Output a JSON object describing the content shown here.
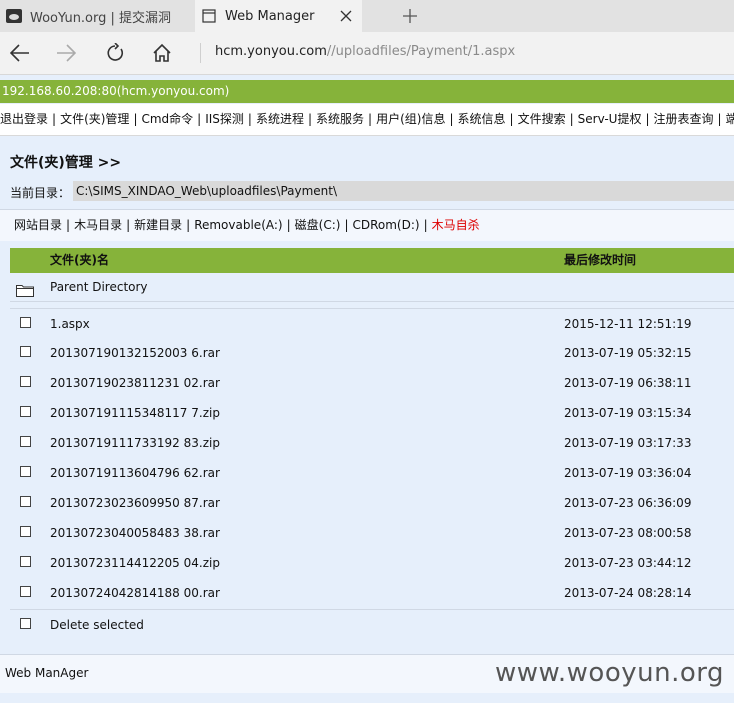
{
  "browser": {
    "tabs": [
      {
        "title": "WooYun.org | 提交漏洞"
      },
      {
        "title": "Web Manager"
      }
    ],
    "url_host": "hcm.yonyou.com",
    "url_path": "//uploadfiles/Payment/1.aspx"
  },
  "host_info": "192.168.60.208:80(hcm.yonyou.com)",
  "menu": [
    "退出登录",
    "文件(夹)管理",
    "Cmd命令",
    "IIS探测",
    "系统进程",
    "系统服务",
    "用户(组)信息",
    "系统信息",
    "文件搜索",
    "Serv-U提权",
    "注册表查询",
    "端口"
  ],
  "page_title": "文件(夹)管理 >>",
  "current_dir": {
    "label": "当前目录：",
    "value": "C:\\SIMS_XINDAO_Web\\uploadfiles\\Payment\\"
  },
  "drives": [
    "网站目录",
    "木马目录",
    "新建目录",
    "Removable(A:)",
    "磁盘(C:)",
    "CDRom(D:)"
  ],
  "self_kill": "木马自杀",
  "table": {
    "col_name": "文件(夹)名",
    "col_time": "最后修改时间",
    "parent": "Parent Directory",
    "files": [
      {
        "name": "1.aspx",
        "time": "2015-12-11 12:51:19"
      },
      {
        "name": "201307190132152003 6.rar",
        "time": "2013-07-19 05:32:15"
      },
      {
        "name": "20130719023811231 02.rar",
        "time": "2013-07-19 06:38:11"
      },
      {
        "name": "201307191115348117 7.zip",
        "time": "2013-07-19 03:15:34"
      },
      {
        "name": "20130719111733192 83.zip",
        "time": "2013-07-19 03:17:33"
      },
      {
        "name": "20130719113604796 62.rar",
        "time": "2013-07-19 03:36:04"
      },
      {
        "name": "20130723023609950 87.rar",
        "time": "2013-07-23 06:36:09"
      },
      {
        "name": "20130723040058483 38.rar",
        "time": "2013-07-23 08:00:58"
      },
      {
        "name": "20130723114412205 04.zip",
        "time": "2013-07-23 03:44:12"
      },
      {
        "name": "20130724042814188 00.rar",
        "time": "2013-07-24 08:28:14"
      }
    ],
    "delete_label": "Delete selected"
  },
  "footer": "Web ManAger",
  "watermark": "www.wooyun.org"
}
